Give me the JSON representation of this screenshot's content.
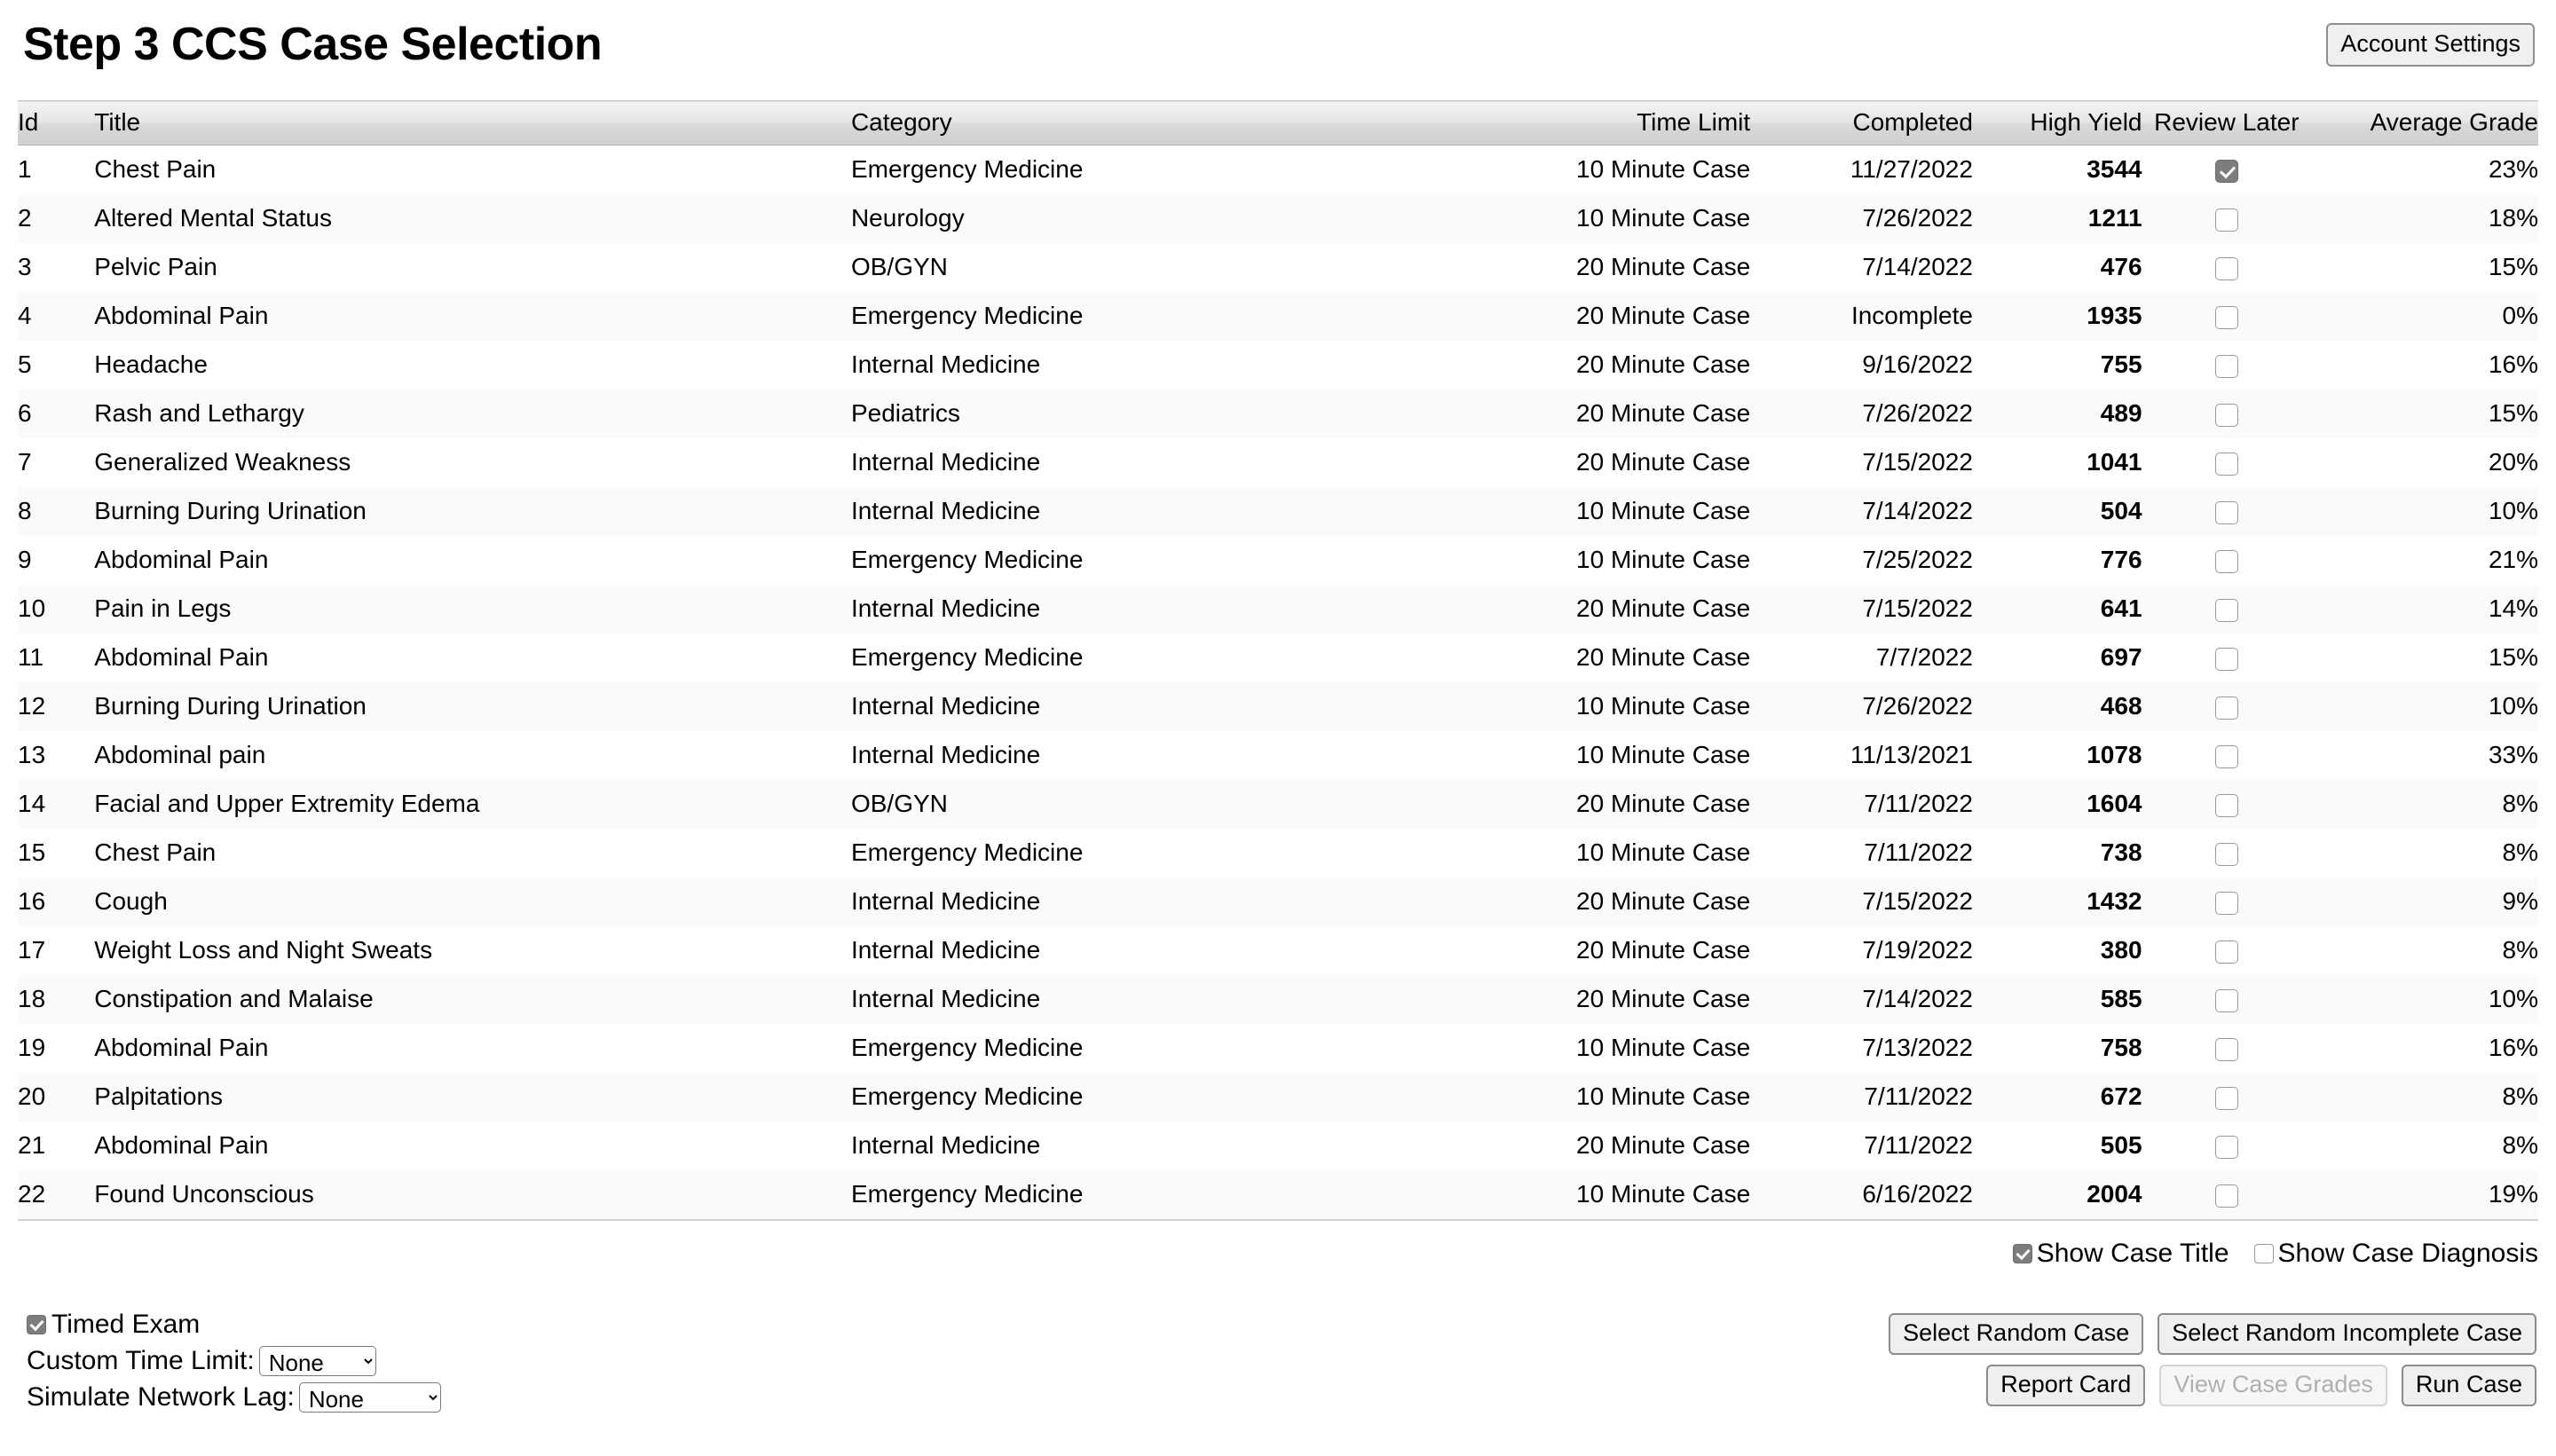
{
  "header": {
    "title": "Step 3 CCS Case Selection",
    "account_settings_label": "Account Settings"
  },
  "table": {
    "columns": [
      {
        "key": "id",
        "label": "Id"
      },
      {
        "key": "title",
        "label": "Title"
      },
      {
        "key": "category",
        "label": "Category"
      },
      {
        "key": "time_limit",
        "label": "Time Limit"
      },
      {
        "key": "completed",
        "label": "Completed"
      },
      {
        "key": "high_yield",
        "label": "High Yield"
      },
      {
        "key": "review_later",
        "label": "Review Later"
      },
      {
        "key": "average_grade",
        "label": "Average Grade"
      }
    ],
    "rows": [
      {
        "id": "1",
        "title": "Chest Pain",
        "category": "Emergency Medicine",
        "time_limit": "10 Minute Case",
        "completed": "11/27/2022",
        "high_yield": "3544",
        "review_later": true,
        "average_grade": "23%"
      },
      {
        "id": "2",
        "title": "Altered Mental Status",
        "category": "Neurology",
        "time_limit": "10 Minute Case",
        "completed": "7/26/2022",
        "high_yield": "1211",
        "review_later": false,
        "average_grade": "18%"
      },
      {
        "id": "3",
        "title": "Pelvic Pain",
        "category": "OB/GYN",
        "time_limit": "20 Minute Case",
        "completed": "7/14/2022",
        "high_yield": "476",
        "review_later": false,
        "average_grade": "15%"
      },
      {
        "id": "4",
        "title": "Abdominal Pain",
        "category": "Emergency Medicine",
        "time_limit": "20 Minute Case",
        "completed": "Incomplete",
        "high_yield": "1935",
        "review_later": false,
        "average_grade": "0%"
      },
      {
        "id": "5",
        "title": "Headache",
        "category": "Internal Medicine",
        "time_limit": "20 Minute Case",
        "completed": "9/16/2022",
        "high_yield": "755",
        "review_later": false,
        "average_grade": "16%"
      },
      {
        "id": "6",
        "title": "Rash and Lethargy",
        "category": "Pediatrics",
        "time_limit": "20 Minute Case",
        "completed": "7/26/2022",
        "high_yield": "489",
        "review_later": false,
        "average_grade": "15%"
      },
      {
        "id": "7",
        "title": "Generalized Weakness",
        "category": "Internal Medicine",
        "time_limit": "20 Minute Case",
        "completed": "7/15/2022",
        "high_yield": "1041",
        "review_later": false,
        "average_grade": "20%"
      },
      {
        "id": "8",
        "title": "Burning During Urination",
        "category": "Internal Medicine",
        "time_limit": "10 Minute Case",
        "completed": "7/14/2022",
        "high_yield": "504",
        "review_later": false,
        "average_grade": "10%"
      },
      {
        "id": "9",
        "title": "Abdominal Pain",
        "category": "Emergency Medicine",
        "time_limit": "10 Minute Case",
        "completed": "7/25/2022",
        "high_yield": "776",
        "review_later": false,
        "average_grade": "21%"
      },
      {
        "id": "10",
        "title": "Pain in Legs",
        "category": "Internal Medicine",
        "time_limit": "20 Minute Case",
        "completed": "7/15/2022",
        "high_yield": "641",
        "review_later": false,
        "average_grade": "14%"
      },
      {
        "id": "11",
        "title": "Abdominal Pain",
        "category": "Emergency Medicine",
        "time_limit": "20 Minute Case",
        "completed": "7/7/2022",
        "high_yield": "697",
        "review_later": false,
        "average_grade": "15%"
      },
      {
        "id": "12",
        "title": "Burning During Urination",
        "category": "Internal Medicine",
        "time_limit": "10 Minute Case",
        "completed": "7/26/2022",
        "high_yield": "468",
        "review_later": false,
        "average_grade": "10%"
      },
      {
        "id": "13",
        "title": "Abdominal pain",
        "category": "Internal Medicine",
        "time_limit": "10 Minute Case",
        "completed": "11/13/2021",
        "high_yield": "1078",
        "review_later": false,
        "average_grade": "33%"
      },
      {
        "id": "14",
        "title": "Facial and Upper Extremity Edema",
        "category": "OB/GYN",
        "time_limit": "20 Minute Case",
        "completed": "7/11/2022",
        "high_yield": "1604",
        "review_later": false,
        "average_grade": "8%"
      },
      {
        "id": "15",
        "title": "Chest Pain",
        "category": "Emergency Medicine",
        "time_limit": "10 Minute Case",
        "completed": "7/11/2022",
        "high_yield": "738",
        "review_later": false,
        "average_grade": "8%"
      },
      {
        "id": "16",
        "title": "Cough",
        "category": "Internal Medicine",
        "time_limit": "20 Minute Case",
        "completed": "7/15/2022",
        "high_yield": "1432",
        "review_later": false,
        "average_grade": "9%"
      },
      {
        "id": "17",
        "title": "Weight Loss and Night Sweats",
        "category": "Internal Medicine",
        "time_limit": "20 Minute Case",
        "completed": "7/19/2022",
        "high_yield": "380",
        "review_later": false,
        "average_grade": "8%"
      },
      {
        "id": "18",
        "title": "Constipation and Malaise",
        "category": "Internal Medicine",
        "time_limit": "20 Minute Case",
        "completed": "7/14/2022",
        "high_yield": "585",
        "review_later": false,
        "average_grade": "10%"
      },
      {
        "id": "19",
        "title": "Abdominal Pain",
        "category": "Emergency Medicine",
        "time_limit": "10 Minute Case",
        "completed": "7/13/2022",
        "high_yield": "758",
        "review_later": false,
        "average_grade": "16%"
      },
      {
        "id": "20",
        "title": "Palpitations",
        "category": "Emergency Medicine",
        "time_limit": "10 Minute Case",
        "completed": "7/11/2022",
        "high_yield": "672",
        "review_later": false,
        "average_grade": "8%"
      },
      {
        "id": "21",
        "title": "Abdominal Pain",
        "category": "Internal Medicine",
        "time_limit": "20 Minute Case",
        "completed": "7/11/2022",
        "high_yield": "505",
        "review_later": false,
        "average_grade": "8%"
      },
      {
        "id": "22",
        "title": "Found Unconscious",
        "category": "Emergency Medicine",
        "time_limit": "10 Minute Case",
        "completed": "6/16/2022",
        "high_yield": "2004",
        "review_later": false,
        "average_grade": "19%"
      }
    ]
  },
  "display_options": {
    "show_case_title": {
      "label": "Show Case Title",
      "checked": true
    },
    "show_case_diagnosis": {
      "label": "Show Case Diagnosis",
      "checked": false
    }
  },
  "exam_options": {
    "timed_exam": {
      "label": "Timed Exam",
      "checked": true
    },
    "custom_time_limit": {
      "label": "Custom Time Limit:",
      "value": "None",
      "options": [
        "None"
      ]
    },
    "simulate_network_lag": {
      "label": "Simulate Network Lag:",
      "value": "None",
      "options": [
        "None"
      ]
    }
  },
  "actions": {
    "select_random_case": "Select Random Case",
    "select_random_incomplete_case": "Select Random Incomplete Case",
    "report_card": "Report Card",
    "view_case_grades": "View Case Grades",
    "run_case": "Run Case"
  }
}
